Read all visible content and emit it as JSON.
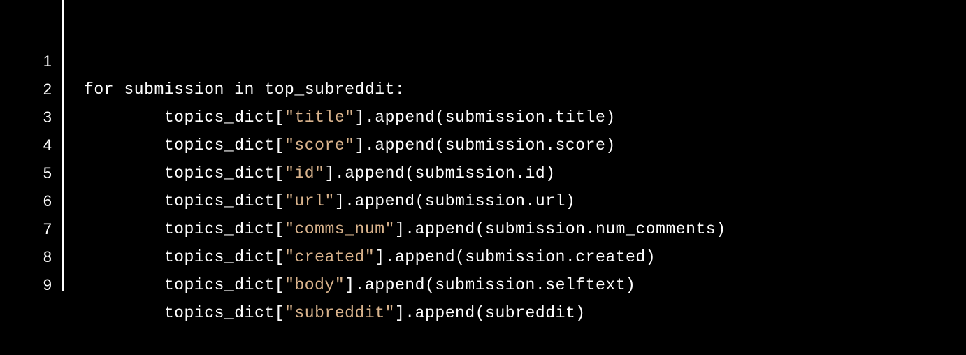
{
  "colors": {
    "background": "#000000",
    "text": "#ffffff",
    "string": "#d9b38c",
    "divider": "#ffffff"
  },
  "lines": [
    {
      "number": "1",
      "indent": "",
      "code": "for submission in top_subreddit:"
    },
    {
      "number": "2",
      "indent": "        ",
      "pre": "topics_dict[",
      "str": "\"title\"",
      "post": "].append(submission.title)"
    },
    {
      "number": "3",
      "indent": "        ",
      "pre": "topics_dict[",
      "str": "\"score\"",
      "post": "].append(submission.score)"
    },
    {
      "number": "4",
      "indent": "        ",
      "pre": "topics_dict[",
      "str": "\"id\"",
      "post": "].append(submission.id)"
    },
    {
      "number": "5",
      "indent": "        ",
      "pre": "topics_dict[",
      "str": "\"url\"",
      "post": "].append(submission.url)"
    },
    {
      "number": "6",
      "indent": "        ",
      "pre": "topics_dict[",
      "str": "\"comms_num\"",
      "post": "].append(submission.num_comments)"
    },
    {
      "number": "7",
      "indent": "        ",
      "pre": "topics_dict[",
      "str": "\"created\"",
      "post": "].append(submission.created)"
    },
    {
      "number": "8",
      "indent": "        ",
      "pre": "topics_dict[",
      "str": "\"body\"",
      "post": "].append(submission.selftext)"
    },
    {
      "number": "9",
      "indent": "        ",
      "pre": "topics_dict[",
      "str": "\"subreddit\"",
      "post": "].append(subreddit)"
    }
  ]
}
